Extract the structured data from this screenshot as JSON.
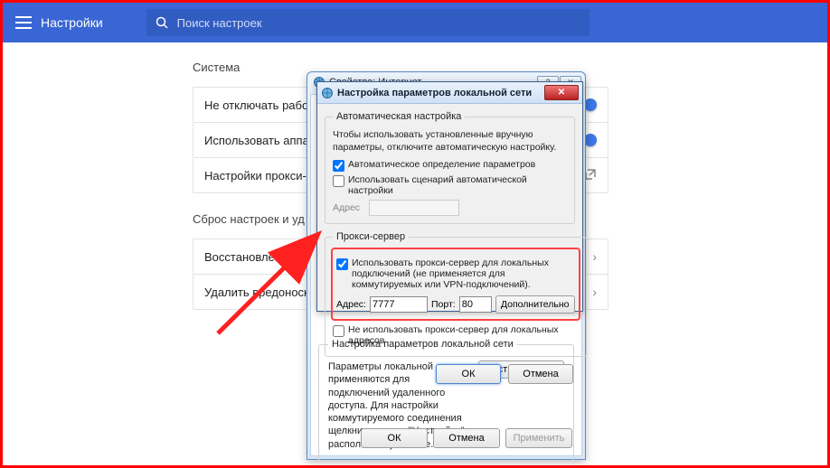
{
  "header": {
    "title": "Настройки",
    "search_placeholder": "Поиск настроек"
  },
  "section_system": "Система",
  "settings": {
    "keep_running": "Не отключать рабо",
    "hw_accel": "Использовать аппа",
    "proxy": "Настройки прокси-о"
  },
  "section_reset": "Сброс настроек и уд",
  "reset": {
    "restore": "Восстановление на",
    "cleanup": "Удалить вредоносн"
  },
  "inet_props": {
    "title": "Свойства: Интернет",
    "lan_group_title": "Настройка параметров локальной сети",
    "lan_text": "Параметры локальной сети не применяются для подключений удаленного доступа. Для настройки коммутируемого соединения щелкните кнопку \"Настройка\", расположенную выше.",
    "lan_btn": "Настройка сети",
    "btn_small": "льно",
    "ok": "ОК",
    "cancel": "Отмена",
    "apply": "Применить"
  },
  "lan": {
    "title": "Настройка параметров локальной сети",
    "auto_group": "Автоматическая настройка",
    "auto_text": "Чтобы использовать установленные вручную параметры, отключите автоматическую настройку.",
    "auto_detect": "Автоматическое определение параметров",
    "use_script": "Использовать сценарий автоматической настройки",
    "address_label": "Адрес",
    "proxy_group": "Прокси-сервер",
    "use_proxy": "Использовать прокси-сервер для локальных подключений (не применяется для коммутируемых или VPN-подключений).",
    "addr_label": "Адрес:",
    "addr_value": "7777",
    "port_label": "Порт:",
    "port_value": "80",
    "advanced": "Дополнительно",
    "bypass_local": "Не использовать прокси-сервер для локальных адресов",
    "ok": "ОК",
    "cancel": "Отмена"
  }
}
